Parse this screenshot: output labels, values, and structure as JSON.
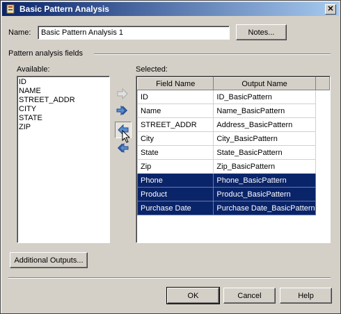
{
  "window": {
    "title": "Basic Pattern Analysis"
  },
  "name": {
    "label": "Name:",
    "value": "Basic Pattern Analysis 1"
  },
  "notes_button": "Notes...",
  "group_label": "Pattern analysis fields",
  "available": {
    "label": "Available:",
    "items": [
      "ID",
      "NAME",
      "STREET_ADDR",
      "CITY",
      "STATE",
      "ZIP"
    ]
  },
  "selected": {
    "label": "Selected:",
    "columns": [
      "Field Name",
      "Output Name"
    ],
    "rows": [
      {
        "field": "ID",
        "output": "ID_BasicPattern",
        "selected": false
      },
      {
        "field": "Name",
        "output": "Name_BasicPattern",
        "selected": false
      },
      {
        "field": "STREET_ADDR",
        "output": "Address_BasicPattern",
        "selected": false
      },
      {
        "field": "City",
        "output": "City_BasicPattern",
        "selected": false
      },
      {
        "field": "State",
        "output": "State_BasicPattern",
        "selected": false
      },
      {
        "field": "Zip",
        "output": "Zip_BasicPattern",
        "selected": false
      },
      {
        "field": "Phone",
        "output": "Phone_BasicPattern",
        "selected": true
      },
      {
        "field": "Product",
        "output": "Product_BasicPattern",
        "selected": true
      },
      {
        "field": "Purchase Date",
        "output": "Purchase Date_BasicPattern",
        "selected": true
      }
    ]
  },
  "transfer_buttons": [
    {
      "icon": "arrow-right-icon",
      "state": "disabled"
    },
    {
      "icon": "double-arrow-right-icon",
      "state": "enabled"
    },
    {
      "icon": "arrow-left-icon",
      "state": "enabled"
    },
    {
      "icon": "double-arrow-left-icon",
      "state": "enabled"
    }
  ],
  "additional_outputs_button": "Additional Outputs...",
  "footer": {
    "ok": "OK",
    "cancel": "Cancel",
    "help": "Help"
  },
  "colors": {
    "selection": "#0a246a",
    "face": "#d4d0c8",
    "title_start": "#0a246a",
    "title_end": "#a6caf0"
  }
}
